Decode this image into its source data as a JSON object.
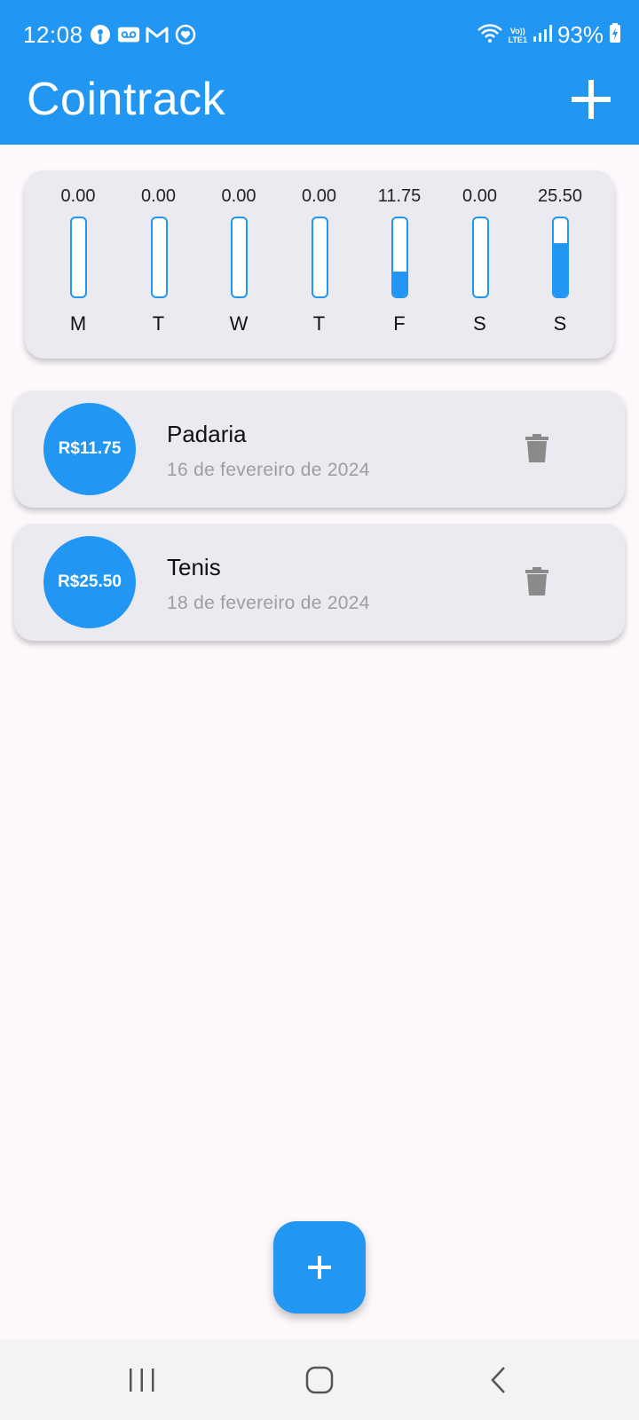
{
  "status_bar": {
    "time": "12:08",
    "battery": "93%",
    "network_top": "Vo))",
    "network_bottom": "LTE1",
    "left_icons": [
      "podcast-icon",
      "voicemail-icon",
      "gmail-icon",
      "health-icon"
    ],
    "right_icons": [
      "wifi-icon",
      "signal-icon",
      "battery-charging-icon"
    ]
  },
  "app_bar": {
    "title": "Cointrack",
    "action_icon": "plus-icon"
  },
  "weekly_chart": {
    "days": [
      {
        "label": "M",
        "amount": "0.00",
        "fill": 0.0
      },
      {
        "label": "T",
        "amount": "0.00",
        "fill": 0.0
      },
      {
        "label": "W",
        "amount": "0.00",
        "fill": 0.0
      },
      {
        "label": "T",
        "amount": "0.00",
        "fill": 0.0
      },
      {
        "label": "F",
        "amount": "11.75",
        "fill": 0.3154
      },
      {
        "label": "S",
        "amount": "0.00",
        "fill": 0.0
      },
      {
        "label": "S",
        "amount": "25.50",
        "fill": 0.6846
      }
    ]
  },
  "expenses": [
    {
      "amount": "R$11.75",
      "title": "Padaria",
      "date": "16 de fevereiro de 2024"
    },
    {
      "amount": "R$25.50",
      "title": "Tenis",
      "date": "18 de fevereiro de 2024"
    }
  ],
  "fab": {
    "icon": "plus-icon"
  },
  "nav_bar": {
    "items": [
      "recents-icon",
      "home-icon",
      "back-icon"
    ]
  },
  "colors": {
    "primary": "#2196f3",
    "card": "#eceaf1",
    "background": "#fdf8fc",
    "muted_text": "#9e9e9e",
    "delete_icon": "#8a8a8a"
  }
}
